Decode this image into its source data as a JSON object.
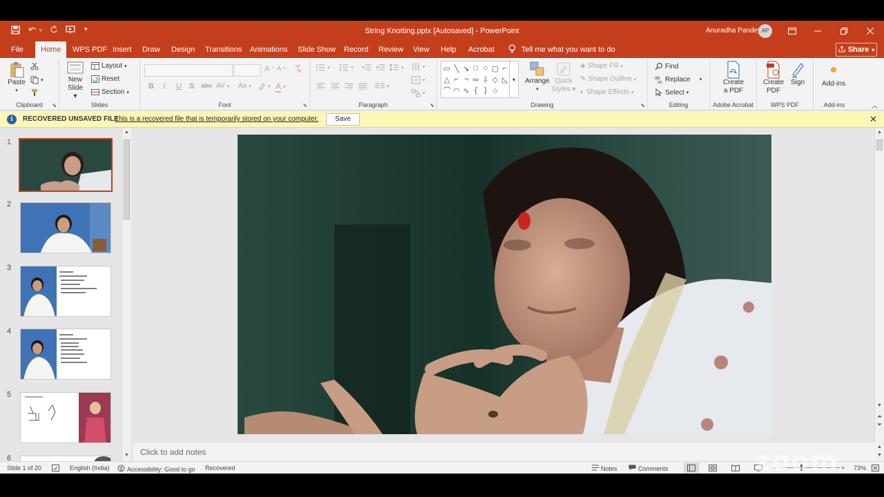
{
  "titlebar": {
    "doc_title": "String Knotting.pptx [Autosaved]  -  PowerPoint",
    "user_name": "Anuradha Pandey",
    "user_initials": "AP",
    "accent_color": "#c43e1c"
  },
  "tabs": [
    "File",
    "Home",
    "WPS PDF",
    "Insert",
    "Draw",
    "Design",
    "Transitions",
    "Animations",
    "Slide Show",
    "Record",
    "Review",
    "View",
    "Help",
    "Acrobat"
  ],
  "active_tab": "Home",
  "tell_me": "Tell me what you want to do",
  "share_label": "Share",
  "ribbon": {
    "clipboard": {
      "label": "Clipboard",
      "paste": "Paste"
    },
    "slides": {
      "label": "Slides",
      "new_slide_1": "New",
      "new_slide_2": "Slide",
      "layout": "Layout",
      "reset": "Reset",
      "section": "Section"
    },
    "font": {
      "label": "Font",
      "bold": "B",
      "italic": "I",
      "underline": "U",
      "strike": "S",
      "spacing": "AV",
      "case": "Aa",
      "color": "A",
      "grow": "A",
      "shrink": "A"
    },
    "paragraph": {
      "label": "Paragraph"
    },
    "drawing": {
      "label": "Drawing",
      "arrange": "Arrange",
      "quick_styles_1": "Quick",
      "quick_styles_2": "Styles",
      "shape_fill": "Shape Fill",
      "shape_outline": "Shape Outline",
      "shape_effects": "Shape Effects"
    },
    "editing": {
      "label": "Editing",
      "find": "Find",
      "replace": "Replace",
      "select": "Select"
    },
    "adobe": {
      "label": "Adobe Acrobat",
      "create_1": "Create",
      "create_2": "a PDF"
    },
    "wps": {
      "label": "WPS PDF",
      "create_1": "Create",
      "create_2": "PDF",
      "sign": "Sign"
    },
    "addins": {
      "label": "Add-ins",
      "addins": "Add-ins"
    }
  },
  "message_bar": {
    "title": "RECOVERED UNSAVED FILE",
    "text": "This is a recovered file that is temporarily stored on your computer.",
    "save": "Save"
  },
  "thumbnails": [
    {
      "num": "1",
      "type": "photo-woman"
    },
    {
      "num": "2",
      "type": "photo-blue"
    },
    {
      "num": "3",
      "type": "photo-text"
    },
    {
      "num": "4",
      "type": "photo-text"
    },
    {
      "num": "5",
      "type": "drawing-statue"
    },
    {
      "num": "6",
      "type": "partial"
    }
  ],
  "notes_placeholder": "Click to add notes",
  "status": {
    "slide": "Slide 1 of 20",
    "language": "English (India)",
    "accessibility": "Accessibility: Good to go",
    "recovered": "Recovered",
    "notes": "Notes",
    "comments": "Comments",
    "zoom": "73%",
    "watermark": "zoom"
  }
}
